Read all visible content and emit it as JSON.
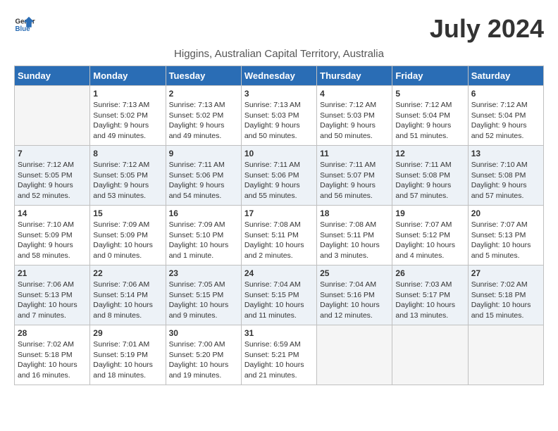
{
  "header": {
    "logo_general": "General",
    "logo_blue": "Blue",
    "month_year": "July 2024",
    "location": "Higgins, Australian Capital Territory, Australia"
  },
  "days_of_week": [
    "Sunday",
    "Monday",
    "Tuesday",
    "Wednesday",
    "Thursday",
    "Friday",
    "Saturday"
  ],
  "weeks": [
    [
      {
        "day": "",
        "info": ""
      },
      {
        "day": "1",
        "info": "Sunrise: 7:13 AM\nSunset: 5:02 PM\nDaylight: 9 hours\nand 49 minutes."
      },
      {
        "day": "2",
        "info": "Sunrise: 7:13 AM\nSunset: 5:02 PM\nDaylight: 9 hours\nand 49 minutes."
      },
      {
        "day": "3",
        "info": "Sunrise: 7:13 AM\nSunset: 5:03 PM\nDaylight: 9 hours\nand 50 minutes."
      },
      {
        "day": "4",
        "info": "Sunrise: 7:12 AM\nSunset: 5:03 PM\nDaylight: 9 hours\nand 50 minutes."
      },
      {
        "day": "5",
        "info": "Sunrise: 7:12 AM\nSunset: 5:04 PM\nDaylight: 9 hours\nand 51 minutes."
      },
      {
        "day": "6",
        "info": "Sunrise: 7:12 AM\nSunset: 5:04 PM\nDaylight: 9 hours\nand 52 minutes."
      }
    ],
    [
      {
        "day": "7",
        "info": "Sunrise: 7:12 AM\nSunset: 5:05 PM\nDaylight: 9 hours\nand 52 minutes."
      },
      {
        "day": "8",
        "info": "Sunrise: 7:12 AM\nSunset: 5:05 PM\nDaylight: 9 hours\nand 53 minutes."
      },
      {
        "day": "9",
        "info": "Sunrise: 7:11 AM\nSunset: 5:06 PM\nDaylight: 9 hours\nand 54 minutes."
      },
      {
        "day": "10",
        "info": "Sunrise: 7:11 AM\nSunset: 5:06 PM\nDaylight: 9 hours\nand 55 minutes."
      },
      {
        "day": "11",
        "info": "Sunrise: 7:11 AM\nSunset: 5:07 PM\nDaylight: 9 hours\nand 56 minutes."
      },
      {
        "day": "12",
        "info": "Sunrise: 7:11 AM\nSunset: 5:08 PM\nDaylight: 9 hours\nand 57 minutes."
      },
      {
        "day": "13",
        "info": "Sunrise: 7:10 AM\nSunset: 5:08 PM\nDaylight: 9 hours\nand 57 minutes."
      }
    ],
    [
      {
        "day": "14",
        "info": "Sunrise: 7:10 AM\nSunset: 5:09 PM\nDaylight: 9 hours\nand 58 minutes."
      },
      {
        "day": "15",
        "info": "Sunrise: 7:09 AM\nSunset: 5:09 PM\nDaylight: 10 hours\nand 0 minutes."
      },
      {
        "day": "16",
        "info": "Sunrise: 7:09 AM\nSunset: 5:10 PM\nDaylight: 10 hours\nand 1 minute."
      },
      {
        "day": "17",
        "info": "Sunrise: 7:08 AM\nSunset: 5:11 PM\nDaylight: 10 hours\nand 2 minutes."
      },
      {
        "day": "18",
        "info": "Sunrise: 7:08 AM\nSunset: 5:11 PM\nDaylight: 10 hours\nand 3 minutes."
      },
      {
        "day": "19",
        "info": "Sunrise: 7:07 AM\nSunset: 5:12 PM\nDaylight: 10 hours\nand 4 minutes."
      },
      {
        "day": "20",
        "info": "Sunrise: 7:07 AM\nSunset: 5:13 PM\nDaylight: 10 hours\nand 5 minutes."
      }
    ],
    [
      {
        "day": "21",
        "info": "Sunrise: 7:06 AM\nSunset: 5:13 PM\nDaylight: 10 hours\nand 7 minutes."
      },
      {
        "day": "22",
        "info": "Sunrise: 7:06 AM\nSunset: 5:14 PM\nDaylight: 10 hours\nand 8 minutes."
      },
      {
        "day": "23",
        "info": "Sunrise: 7:05 AM\nSunset: 5:15 PM\nDaylight: 10 hours\nand 9 minutes."
      },
      {
        "day": "24",
        "info": "Sunrise: 7:04 AM\nSunset: 5:15 PM\nDaylight: 10 hours\nand 11 minutes."
      },
      {
        "day": "25",
        "info": "Sunrise: 7:04 AM\nSunset: 5:16 PM\nDaylight: 10 hours\nand 12 minutes."
      },
      {
        "day": "26",
        "info": "Sunrise: 7:03 AM\nSunset: 5:17 PM\nDaylight: 10 hours\nand 13 minutes."
      },
      {
        "day": "27",
        "info": "Sunrise: 7:02 AM\nSunset: 5:18 PM\nDaylight: 10 hours\nand 15 minutes."
      }
    ],
    [
      {
        "day": "28",
        "info": "Sunrise: 7:02 AM\nSunset: 5:18 PM\nDaylight: 10 hours\nand 16 minutes."
      },
      {
        "day": "29",
        "info": "Sunrise: 7:01 AM\nSunset: 5:19 PM\nDaylight: 10 hours\nand 18 minutes."
      },
      {
        "day": "30",
        "info": "Sunrise: 7:00 AM\nSunset: 5:20 PM\nDaylight: 10 hours\nand 19 minutes."
      },
      {
        "day": "31",
        "info": "Sunrise: 6:59 AM\nSunset: 5:21 PM\nDaylight: 10 hours\nand 21 minutes."
      },
      {
        "day": "",
        "info": ""
      },
      {
        "day": "",
        "info": ""
      },
      {
        "day": "",
        "info": ""
      }
    ]
  ]
}
